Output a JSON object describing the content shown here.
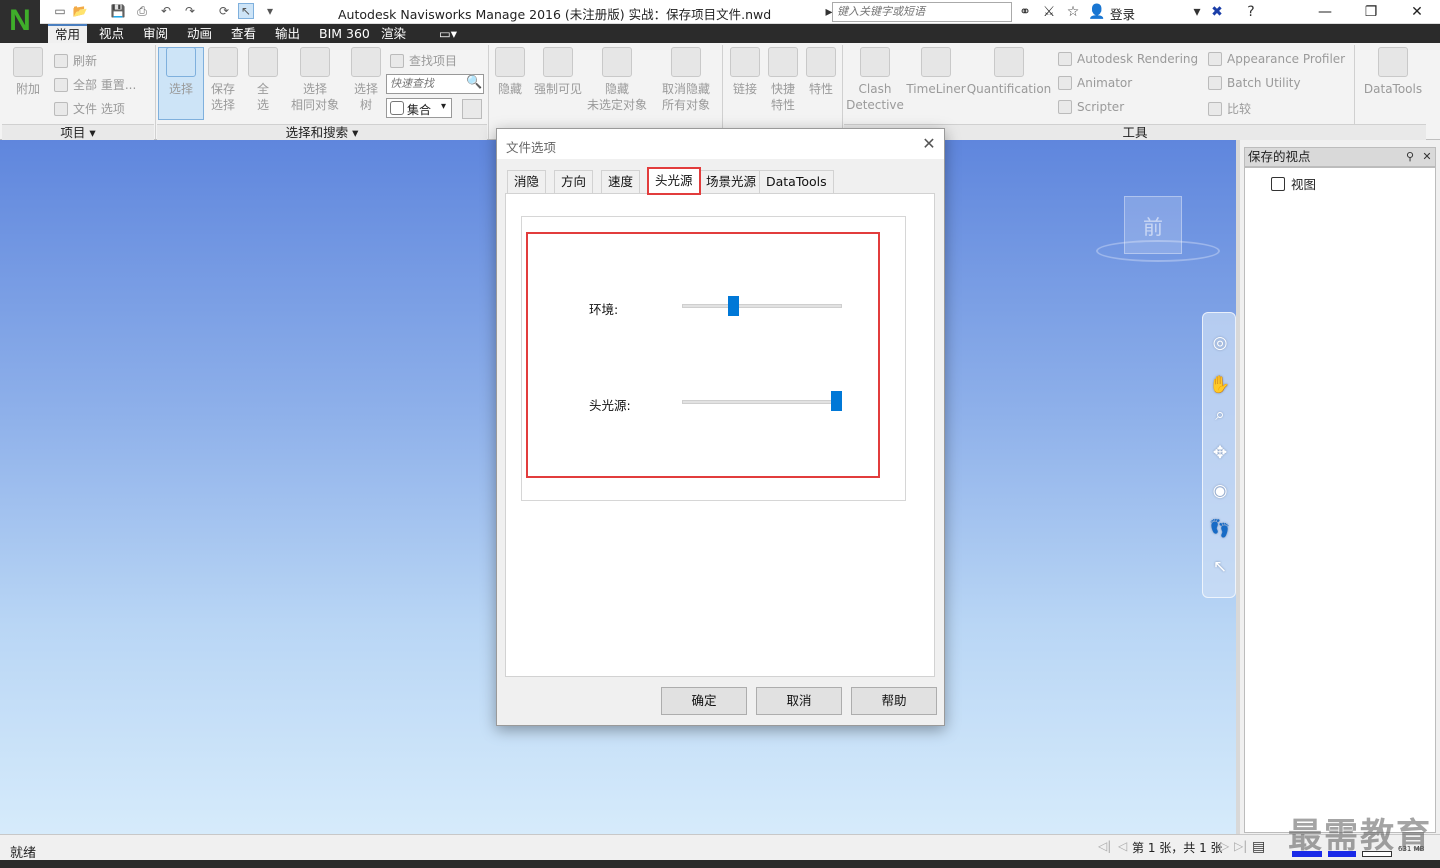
{
  "app": {
    "logo": "N",
    "window_title": "Autodesk Navisworks Manage 2016 (未注册版)    实战：保存项目文件.nwd",
    "search_placeholder": "键入关键字或短语",
    "login": "登录"
  },
  "ribbon_tabs": [
    "常用",
    "视点",
    "审阅",
    "动画",
    "查看",
    "输出",
    "BIM 360",
    "渲染"
  ],
  "ribbon": {
    "project": {
      "title": "项目 ▾",
      "append": "附加",
      "refresh": "刷新",
      "reset_all": "全部 重置...",
      "file_options": "文件 选项"
    },
    "select": {
      "title": "选择和搜索 ▾",
      "select": "选择",
      "save_selection": [
        "保存",
        "选择"
      ],
      "select_all": [
        "全",
        "选"
      ],
      "select_same": [
        "选择",
        "相同对象"
      ],
      "selection_tree": [
        "选择",
        "树"
      ],
      "find_items": "查找项目",
      "quick_find_placeholder": "快速查找",
      "sets": "集合"
    },
    "visibility": {
      "hide": "隐藏",
      "require": "强制可见",
      "hide_unselected": [
        "隐藏",
        "未选定对象"
      ],
      "unhide_all": [
        "取消隐藏",
        "所有对象"
      ]
    },
    "display": {
      "links": "链接",
      "quick_props": [
        "快捷",
        "特性"
      ],
      "properties": "特性"
    },
    "tools": {
      "title": "工具",
      "clash": [
        "Clash",
        "Detective"
      ],
      "timeliner": "TimeLiner",
      "quantification": "Quantification",
      "autodesk_rendering": "Autodesk Rendering",
      "animator": "Animator",
      "scripter": "Scripter",
      "appearance_profiler": "Appearance Profiler",
      "batch_utility": "Batch Utility",
      "compare": "比较",
      "datatools": "DataTools"
    }
  },
  "viewcube_label": "前",
  "saved_viewpoints": {
    "title": "保存的视点",
    "items": [
      "视图"
    ]
  },
  "status": {
    "text": "就绪",
    "page_info": "第 1 张，共 1 张",
    "memory": "631 MB"
  },
  "watermark": "最需教育",
  "dialog": {
    "title": "文件选项",
    "tabs": [
      "消隐",
      "方向",
      "速度",
      "头光源",
      "场景光源",
      "DataTools"
    ],
    "active_tab": "头光源",
    "sliders": [
      {
        "label": "环境:",
        "value": 0.31
      },
      {
        "label": "头光源:",
        "value": 1.0
      }
    ],
    "buttons": {
      "ok": "确定",
      "cancel": "取消",
      "help": "帮助"
    }
  },
  "colors": {
    "highlight": "#e23c3c",
    "slider_thumb": "#0078d7",
    "ribbon_tabs_bg": "#2b2b2b"
  }
}
